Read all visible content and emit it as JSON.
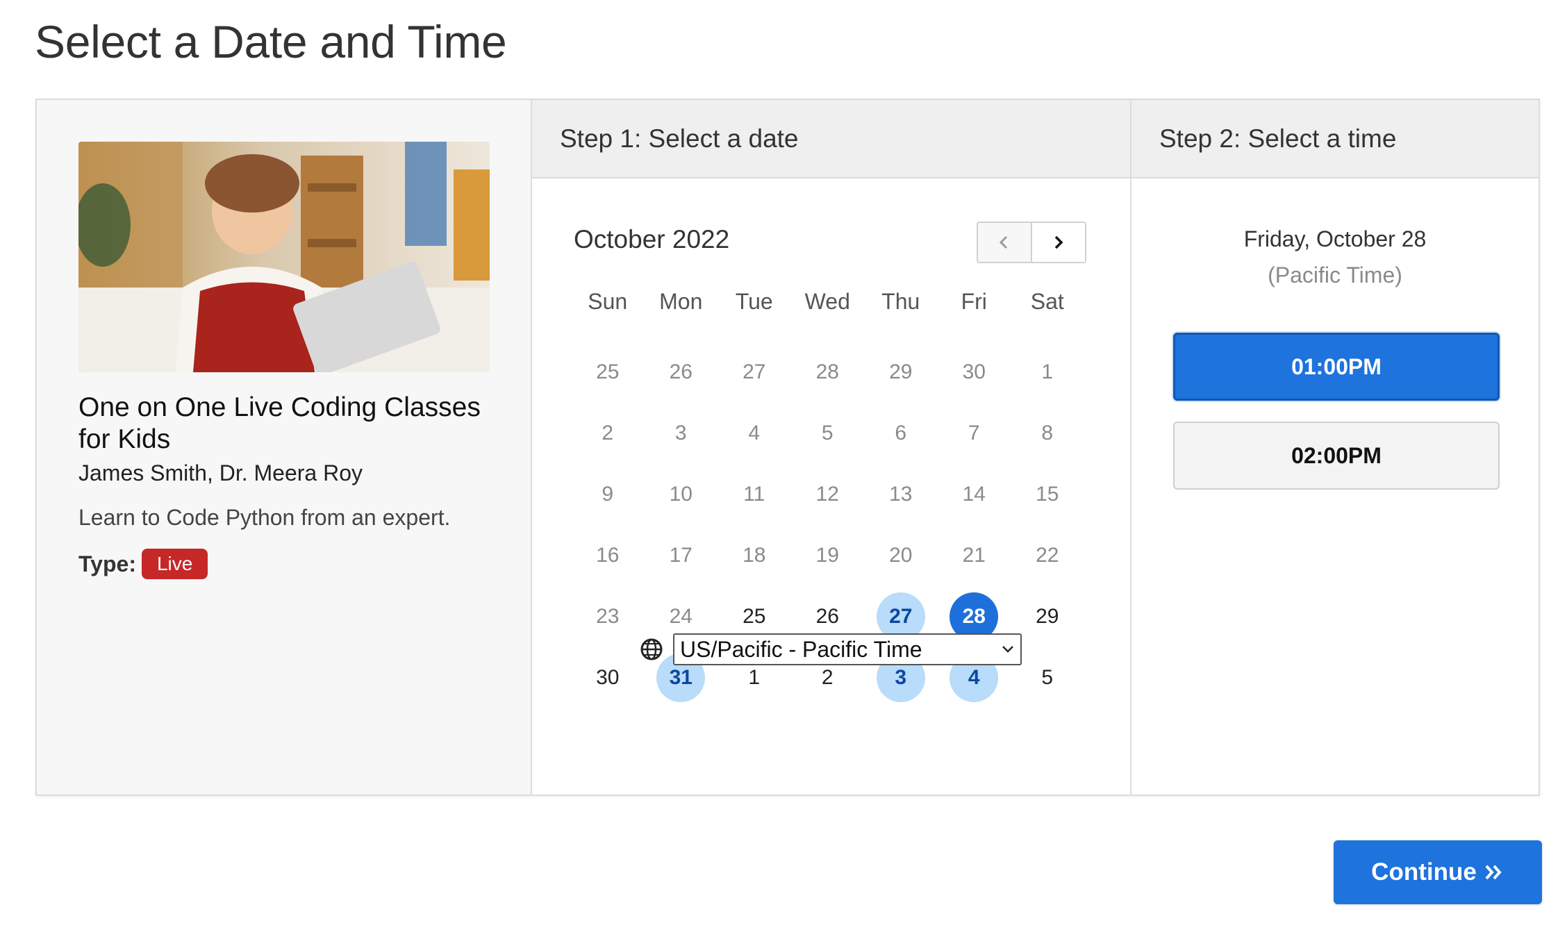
{
  "page": {
    "title": "Select a Date and Time"
  },
  "class_info": {
    "title": "One on One Live Coding Classes for Kids",
    "instructors": "James Smith, Dr. Meera Roy",
    "description": "Learn to Code Python from an expert.",
    "type_label": "Type:",
    "type_value": "Live"
  },
  "step1": {
    "header": "Step 1: Select a date",
    "month": "October 2022",
    "weekdays": [
      "Sun",
      "Mon",
      "Tue",
      "Wed",
      "Thu",
      "Fri",
      "Sat"
    ],
    "weeks": [
      [
        {
          "d": "25",
          "s": "muted"
        },
        {
          "d": "26",
          "s": "muted"
        },
        {
          "d": "27",
          "s": "muted"
        },
        {
          "d": "28",
          "s": "muted"
        },
        {
          "d": "29",
          "s": "muted"
        },
        {
          "d": "30",
          "s": "muted"
        },
        {
          "d": "1",
          "s": "muted"
        }
      ],
      [
        {
          "d": "2",
          "s": "muted"
        },
        {
          "d": "3",
          "s": "muted"
        },
        {
          "d": "4",
          "s": "muted"
        },
        {
          "d": "5",
          "s": "muted"
        },
        {
          "d": "6",
          "s": "muted"
        },
        {
          "d": "7",
          "s": "muted"
        },
        {
          "d": "8",
          "s": "muted"
        }
      ],
      [
        {
          "d": "9",
          "s": "muted"
        },
        {
          "d": "10",
          "s": "muted"
        },
        {
          "d": "11",
          "s": "muted"
        },
        {
          "d": "12",
          "s": "muted"
        },
        {
          "d": "13",
          "s": "muted"
        },
        {
          "d": "14",
          "s": "muted"
        },
        {
          "d": "15",
          "s": "muted"
        }
      ],
      [
        {
          "d": "16",
          "s": "muted"
        },
        {
          "d": "17",
          "s": "muted"
        },
        {
          "d": "18",
          "s": "muted"
        },
        {
          "d": "19",
          "s": "muted"
        },
        {
          "d": "20",
          "s": "muted"
        },
        {
          "d": "21",
          "s": "muted"
        },
        {
          "d": "22",
          "s": "muted"
        }
      ],
      [
        {
          "d": "23",
          "s": "muted"
        },
        {
          "d": "24",
          "s": "muted"
        },
        {
          "d": "25",
          "s": "normal"
        },
        {
          "d": "26",
          "s": "normal"
        },
        {
          "d": "27",
          "s": "avail"
        },
        {
          "d": "28",
          "s": "selected"
        },
        {
          "d": "29",
          "s": "normal"
        }
      ],
      [
        {
          "d": "30",
          "s": "normal"
        },
        {
          "d": "31",
          "s": "avail"
        },
        {
          "d": "1",
          "s": "normal"
        },
        {
          "d": "2",
          "s": "normal"
        },
        {
          "d": "3",
          "s": "avail"
        },
        {
          "d": "4",
          "s": "avail"
        },
        {
          "d": "5",
          "s": "normal"
        }
      ]
    ],
    "timezone": "US/Pacific - Pacific Time"
  },
  "step2": {
    "header": "Step 2: Select a time",
    "selected_date": "Friday, October 28",
    "timezone_note": "(Pacific Time)",
    "slots": [
      "01:00PM",
      "02:00PM"
    ],
    "selected_slot": "01:00PM"
  },
  "actions": {
    "continue_label": "Continue"
  },
  "colors": {
    "primary": "#1e73dc",
    "available": "#b8dcf9",
    "badge": "#c62828"
  }
}
